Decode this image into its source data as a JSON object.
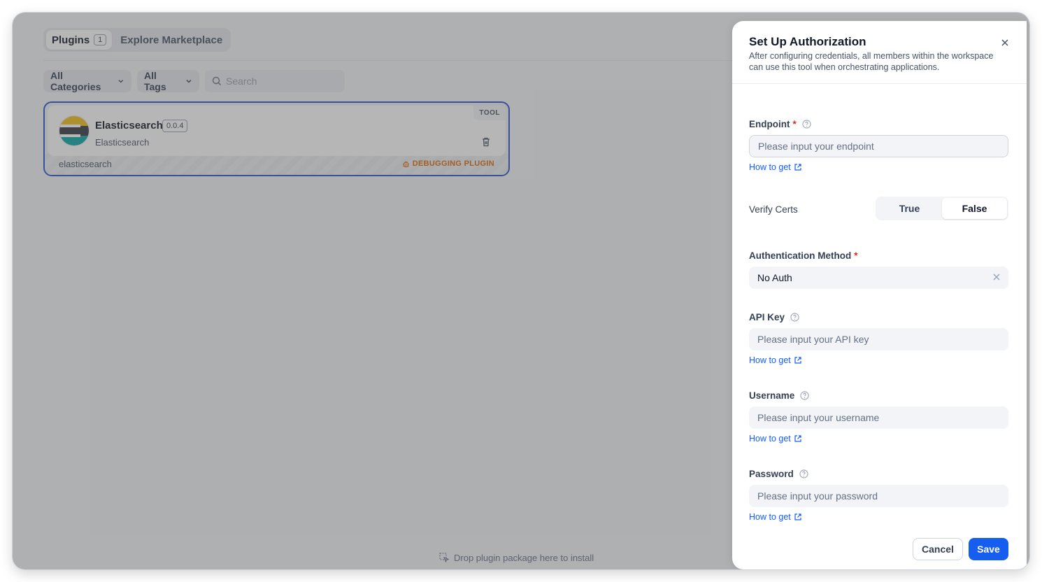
{
  "colors": {
    "accent": "#155eef",
    "required": "#d92d20",
    "debug": "#dc6803",
    "card_border": "#2d4fd1"
  },
  "tabs": [
    {
      "label": "Plugins",
      "count": "1",
      "active": true
    },
    {
      "label": "Explore Marketplace",
      "active": false
    }
  ],
  "filters": {
    "categories": "All Categories",
    "tags": "All Tags",
    "search_placeholder": "Search"
  },
  "plugin_card": {
    "name": "Elasticsearch",
    "version": "0.0.4",
    "subtitle": "Elasticsearch",
    "type_tag": "TOOL",
    "id": "elasticsearch",
    "debug_label": "DEBUGGING PLUGIN"
  },
  "dropzone_text": "Drop plugin package here to install",
  "drawer": {
    "title": "Set Up Authorization",
    "description": "After configuring credentials, all members within the workspace can use this tool when orchestrating applications.",
    "how_to_get": "How to get",
    "endpoint": {
      "label": "Endpoint",
      "required": "*",
      "placeholder": "Please input your endpoint"
    },
    "verify_certs": {
      "label": "Verify Certs",
      "options": [
        "True",
        "False"
      ],
      "selected": "False"
    },
    "auth_method": {
      "label": "Authentication Method",
      "required": "*",
      "value": "No Auth"
    },
    "api_key": {
      "label": "API Key",
      "placeholder": "Please input your API key"
    },
    "username": {
      "label": "Username",
      "placeholder": "Please input your username"
    },
    "password": {
      "label": "Password",
      "placeholder": "Please input your password"
    },
    "cancel": "Cancel",
    "save": "Save"
  }
}
